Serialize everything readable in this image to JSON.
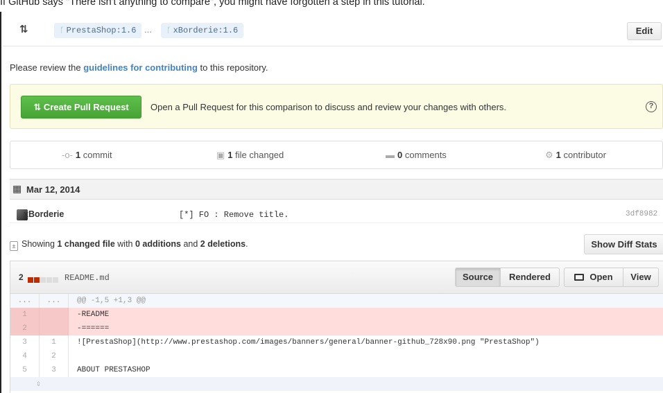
{
  "intro_text": "If GitHub says \"There isn't anything to compare\", you might have forgotten a step in this tutorial.",
  "range": {
    "icon": "compare-icon",
    "base": "PrestaShop:1.6",
    "dots": "...",
    "head": "xBorderie:1.6",
    "edit_label": "Edit"
  },
  "guidelines": {
    "before": "Please review the ",
    "link": "guidelines for contributing",
    "after": " to this repository."
  },
  "pull_request": {
    "button_label": "Create Pull Request",
    "button_icon": "pull-request-icon",
    "message": "Open a Pull Request for this comparison to discuss and review your changes with others.",
    "help_icon": "question-icon"
  },
  "stats": [
    {
      "icon": "commit-icon",
      "count": "1",
      "label": " commit"
    },
    {
      "icon": "file-diff-icon",
      "count": "1",
      "label": " file changed"
    },
    {
      "icon": "comment-icon",
      "count": "0",
      "label": " comments"
    },
    {
      "icon": "contributor-icon",
      "count": "1",
      "label": " contributor"
    }
  ],
  "commits": {
    "date": "Mar 12, 2014",
    "author": "xBorderie",
    "message": "[*] FO : Remove title.",
    "sha": "3df8982"
  },
  "toc": {
    "prefix": "Showing ",
    "changed": "1 changed file",
    "with": " with ",
    "additions": "0 additions",
    "and": " and ",
    "deletions": "2 deletions",
    "suffix": ".",
    "diff_stats_label": "Show Diff Stats"
  },
  "file": {
    "change_count": "2",
    "name": "README.md",
    "source_label": "Source",
    "rendered_label": "Rendered",
    "open_label": "Open",
    "view_label": "View",
    "diff_lines": [
      {
        "type": "hunk",
        "old": "...",
        "new": "...",
        "code": "@@ -1,5 +1,3 @@"
      },
      {
        "type": "del",
        "old": "1",
        "new": "",
        "code": "-README"
      },
      {
        "type": "del",
        "old": "2",
        "new": "",
        "code": "-======"
      },
      {
        "type": "ctx",
        "old": "3",
        "new": "1",
        "code": " ![PrestaShop](http://www.prestashop.com/images/banners/general/banner-github_728x90.png \"PrestaShop\")"
      },
      {
        "type": "ctx",
        "old": "4",
        "new": "2",
        "code": ""
      },
      {
        "type": "ctx",
        "old": "5",
        "new": "3",
        "code": " ABOUT PRESTASHOP"
      }
    ]
  }
}
